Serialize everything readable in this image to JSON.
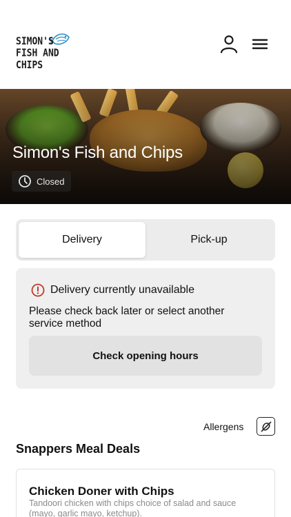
{
  "brand": {
    "logo_line1": "SIMON'S",
    "logo_line2": "FISH AND CHIPS"
  },
  "header": {
    "account_icon": "user-icon",
    "menu_icon": "hamburger-menu-icon"
  },
  "hero": {
    "title": "Simon's Fish and Chips",
    "status": "Closed",
    "status_icon": "clock-icon"
  },
  "service": {
    "options": [
      "Delivery",
      "Pick-up"
    ],
    "selected": "Delivery"
  },
  "notice": {
    "icon": "info-icon",
    "title": "Delivery currently unavailable",
    "body": "Please check back later or select another service method",
    "button_label": "Check opening hours",
    "accent": "#c0392b"
  },
  "allergens": {
    "label": "Allergens",
    "icon": "allergens-icon"
  },
  "menu_section": {
    "title": "Snappers Meal Deals",
    "items": [
      {
        "name": "Chicken Doner with Chips",
        "description": "Tandoori chicken with chips choice of salad and sauce (mayo, garlic mayo, ketchup)."
      }
    ]
  }
}
